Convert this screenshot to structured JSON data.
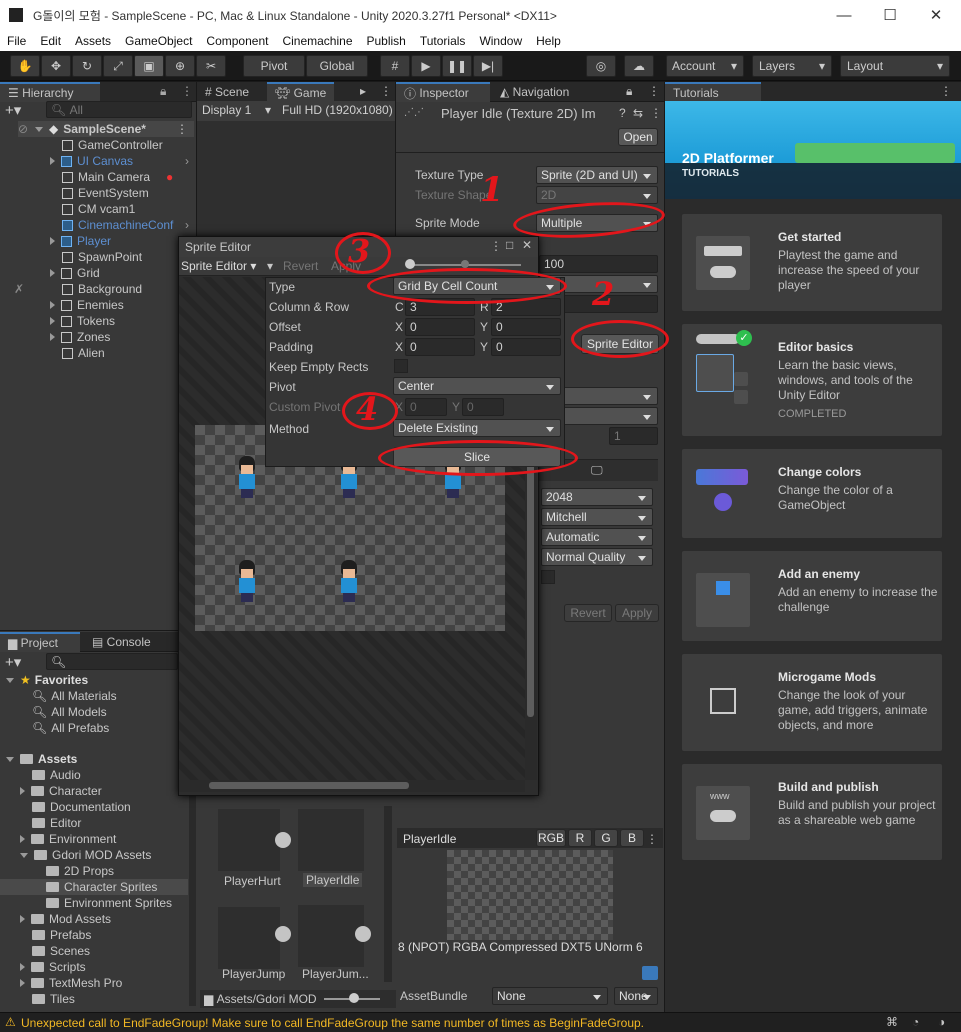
{
  "window": {
    "title": "G돌이의 모험 - SampleScene - PC, Mac & Linux Standalone - Unity 2020.3.27f1 Personal* <DX11>",
    "minimize": "—",
    "maximize": "☐",
    "close": "✕"
  },
  "menu": [
    "File",
    "Edit",
    "Assets",
    "GameObject",
    "Component",
    "Cinemachine",
    "Publish",
    "Tutorials",
    "Window",
    "Help"
  ],
  "toolbar": {
    "pivot": "Pivot",
    "global": "Global",
    "account": "Account",
    "layers": "Layers",
    "layout": "Layout"
  },
  "hierarchy": {
    "tab": "Hierarchy",
    "search_placeholder": "All",
    "scene": "SampleScene*",
    "items": [
      "GameController",
      "UI Canvas",
      "Main Camera",
      "EventSystem",
      "CM vcam1",
      "CinemachineConf",
      "Player",
      "SpawnPoint",
      "Grid",
      "Background",
      "Enemies",
      "Tokens",
      "Zones",
      "Alien"
    ]
  },
  "scene_tabs": {
    "scene": "Scene",
    "game": "Game",
    "display": "Display 1",
    "resolution": "Full HD (1920x1080)"
  },
  "inspector": {
    "tab": "Inspector",
    "nav_tab": "Navigation",
    "title": "Player Idle (Texture 2D) Im",
    "open": "Open",
    "texture_type_label": "Texture Type",
    "texture_type": "Sprite (2D and UI)",
    "texture_shape_label": "Texture Shape",
    "texture_shape": "2D",
    "sprite_mode_label": "Sprite Mode",
    "sprite_mode": "Multiple",
    "ppu": "100",
    "sprite_editor": "Sprite Editor",
    "wrap_partial": "np",
    "filter_partial": "ear",
    "aniso": "1",
    "max_size": "2048",
    "resize": "Mitchell",
    "format": "Automatic",
    "compression": "Normal Quality",
    "revert": "Revert",
    "apply": "Apply",
    "preview_title": "PlayerIdle",
    "channels": [
      "RGB",
      "R",
      "G",
      "B"
    ],
    "info": "8 (NPOT)  RGBA Compressed DXT5 UNorm  6",
    "assetbundle_label": "AssetBundle",
    "assetbundle": "None",
    "variant": "None"
  },
  "sprite_editor": {
    "title": "Sprite Editor",
    "menu": "Sprite Editor",
    "revert": "Revert",
    "apply": "Apply",
    "type_label": "Type",
    "type": "Grid By Cell Count",
    "colrow_label": "Column & Row",
    "c_label": "C",
    "c": "3",
    "r_label": "R",
    "r": "2",
    "offset_label": "Offset",
    "padding_label": "Padding",
    "x_label": "X",
    "y_label": "Y",
    "zero": "0",
    "keep_empty": "Keep Empty Rects",
    "pivot_label": "Pivot",
    "pivot": "Center",
    "custom_pivot": "Custom Pivot",
    "method_label": "Method",
    "method": "Delete Existing",
    "slice": "Slice"
  },
  "annotations": [
    "1",
    "2",
    "3",
    "4"
  ],
  "project": {
    "tab": "Project",
    "console_tab": "Console",
    "favorites": "Favorites",
    "fav_items": [
      "All Materials",
      "All Models",
      "All Prefabs"
    ],
    "assets": "Assets",
    "tree": [
      "Audio",
      "Character",
      "Documentation",
      "Editor",
      "Environment",
      "Gdori MOD Assets",
      "2D Props",
      "Character Sprites",
      "Environment Sprites",
      "Mod Assets",
      "Prefabs",
      "Scenes",
      "Scripts",
      "TextMesh Pro",
      "Tiles"
    ],
    "assets_grid": [
      "PlayerHurt",
      "PlayerIdle",
      "PlayerJump",
      "PlayerJum..."
    ],
    "path": "Assets/Gdori MOD"
  },
  "tutorials": {
    "tab": "Tutorials",
    "banner_title": "2D Platformer",
    "banner_sub": "TUTORIALS",
    "cards": [
      {
        "title": "Get started",
        "desc": "Playtest the game and increase the speed of your player",
        "status": ""
      },
      {
        "title": "Editor basics",
        "desc": "Learn the basic views, windows, and tools of the Unity Editor",
        "status": "COMPLETED"
      },
      {
        "title": "Change colors",
        "desc": "Change the color of a GameObject",
        "status": ""
      },
      {
        "title": "Add an enemy",
        "desc": "Add an enemy to increase the challenge",
        "status": ""
      },
      {
        "title": "Microgame Mods",
        "desc": "Change the look of your game, add triggers, animate objects, and more",
        "status": ""
      },
      {
        "title": "Build and publish",
        "desc": "Build and publish your project as a shareable web game",
        "status": ""
      }
    ],
    "www": "www"
  },
  "status": {
    "warning": "Unexpected call to EndFadeGroup! Make sure to call EndFadeGroup the same number of times as BeginFadeGroup."
  },
  "colors": {
    "accent": "#3a79bb",
    "annotation": "#e3161b",
    "warning": "#f2b824",
    "banner": "#1e9dd8"
  }
}
